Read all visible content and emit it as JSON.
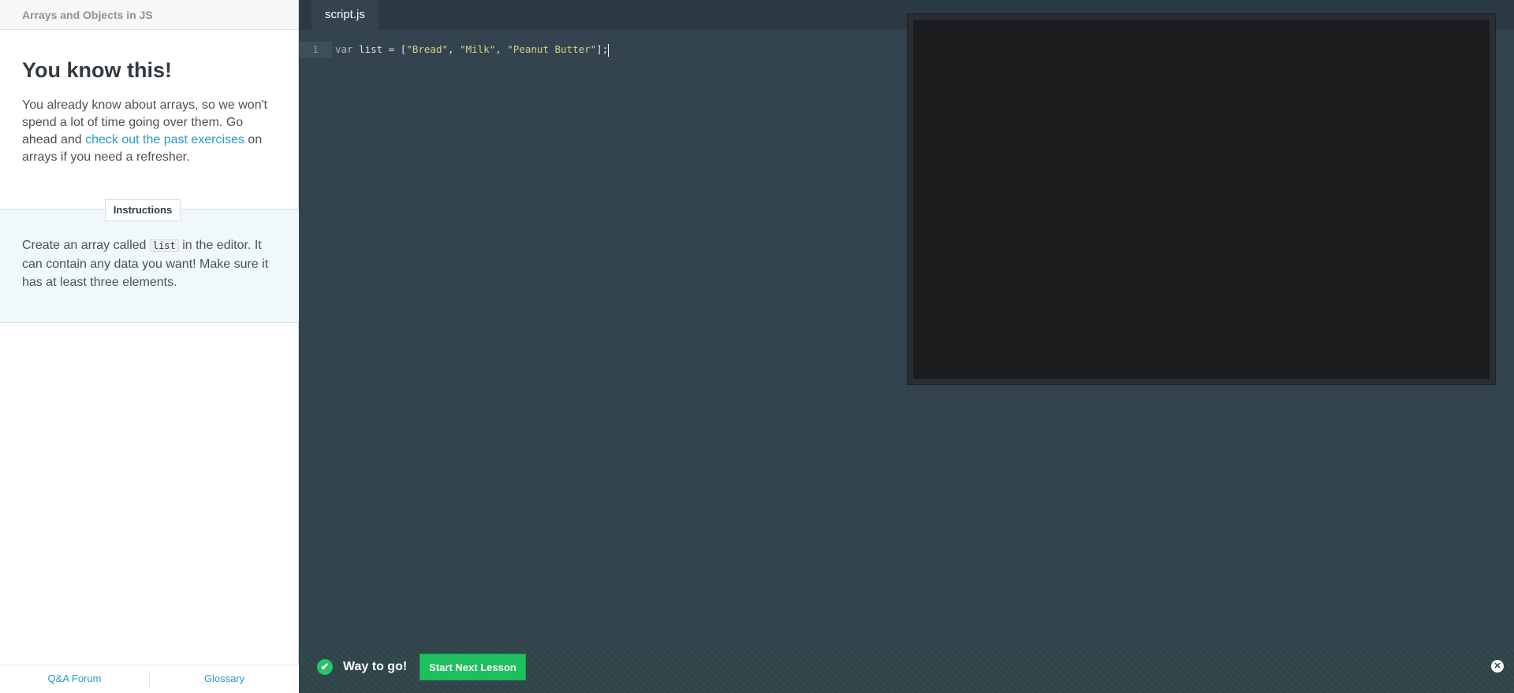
{
  "sidebar": {
    "header": "Arrays and Objects in JS",
    "lesson_title": "You know this!",
    "body_part1": "You already know about arrays, so we won't spend a lot of time going over them. Go ahead and ",
    "body_link": "check out the past exercises",
    "body_part2": " on arrays if you need a refresher.",
    "instructions_label": "Instructions",
    "instructions_part1": "Create an array called ",
    "instructions_code": "list",
    "instructions_part2": " in the editor. It can contain any data you want! Make sure it has at least three elements.",
    "footer": {
      "qa_forum": "Q&A Forum",
      "glossary": "Glossary"
    }
  },
  "editor": {
    "tab_label": "script.js",
    "line_number": "1",
    "code": {
      "keyword": "var",
      "identifier": " list = [",
      "str1": "\"Bread\"",
      "sep1": ", ",
      "str2": "\"Milk\"",
      "sep2": ", ",
      "str3": "\"Peanut Butter\"",
      "end": "];"
    }
  },
  "feedback": {
    "check_icon": "✔",
    "message": "Way to go!",
    "next_button": "Start Next Lesson",
    "close_icon": "✕"
  },
  "colors": {
    "editor_bg": "#34444f",
    "success_green": "#1ebf5f",
    "link_blue": "#2a9ac9"
  }
}
